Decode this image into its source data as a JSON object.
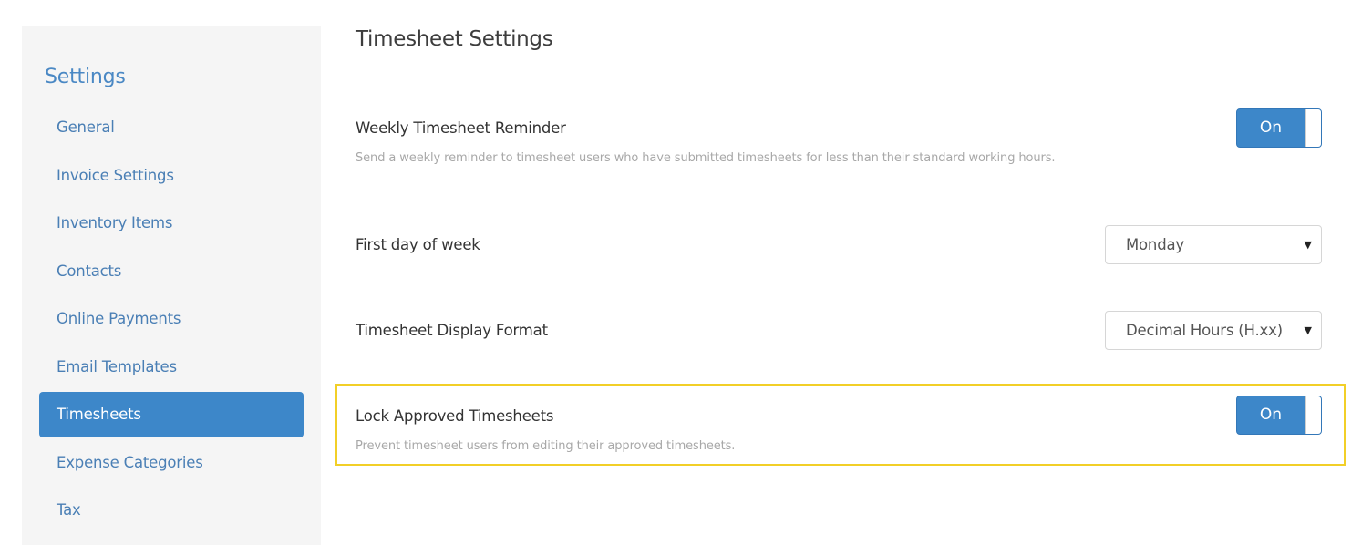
{
  "sidebar": {
    "title": "Settings",
    "items": [
      {
        "label": "General",
        "active": false
      },
      {
        "label": "Invoice Settings",
        "active": false
      },
      {
        "label": "Inventory Items",
        "active": false
      },
      {
        "label": "Contacts",
        "active": false
      },
      {
        "label": "Online Payments",
        "active": false
      },
      {
        "label": "Email Templates",
        "active": false
      },
      {
        "label": "Timesheets",
        "active": true
      },
      {
        "label": "Expense Categories",
        "active": false
      },
      {
        "label": "Tax",
        "active": false
      }
    ]
  },
  "main": {
    "title": "Timesheet Settings",
    "settings": {
      "weekly_reminder": {
        "label": "Weekly Timesheet Reminder",
        "description": "Send a weekly reminder to timesheet users who have submitted timesheets for less than their standard working hours.",
        "toggle_label": "On",
        "enabled": true
      },
      "first_day": {
        "label": "First day of week",
        "selected": "Monday",
        "caret": "▼"
      },
      "display_format": {
        "label": "Timesheet Display Format",
        "selected": "Decimal Hours (H.xx)",
        "caret": "▼"
      },
      "lock_approved": {
        "label": "Lock Approved Timesheets",
        "description": "Prevent timesheet users from editing their approved timesheets.",
        "toggle_label": "On",
        "enabled": true,
        "highlighted": true
      }
    }
  },
  "colors": {
    "accent": "#3d87c9",
    "highlight": "#f2cf27",
    "sidebar_bg": "#f5f5f5"
  }
}
